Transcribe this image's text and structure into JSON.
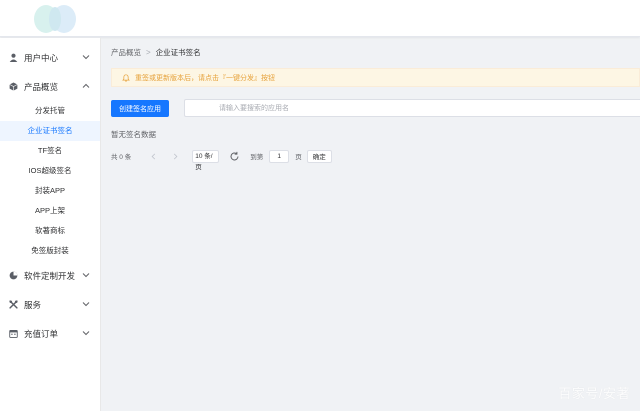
{
  "sidebar": {
    "user_center": "用户中心",
    "product_overview": "产品概览",
    "sub_items": [
      "分发托管",
      "企业证书签名",
      "TF签名",
      "IOS超级签名",
      "封装APP",
      "APP上架",
      "软著商标",
      "免签版封装"
    ],
    "active_sub_index": 1,
    "software_dev": "软件定制开发",
    "services": "服务",
    "recharge_orders": "充值订单"
  },
  "breadcrumb": {
    "root": "产品概览",
    "separator": ">",
    "current": "企业证书签名"
  },
  "notice": {
    "text": "重签或更新版本后，请点击『一键分发』按钮"
  },
  "toolbar": {
    "create_label": "创建签名应用",
    "search_placeholder": "请输入要搜索的应用名"
  },
  "content": {
    "empty_text": "暂无签名数据"
  },
  "pagination": {
    "total_label": "共 0 条",
    "page_size_label": "10 条/页",
    "goto_label": "到第",
    "page_value": "1",
    "page_unit": "页",
    "confirm_label": "确定"
  },
  "watermark": "百家号/安著",
  "colors": {
    "accent": "#1677ff",
    "notice_bg": "#fdf6e4",
    "notice_text": "#e6a23c",
    "page_bg": "#f0f2f5"
  }
}
